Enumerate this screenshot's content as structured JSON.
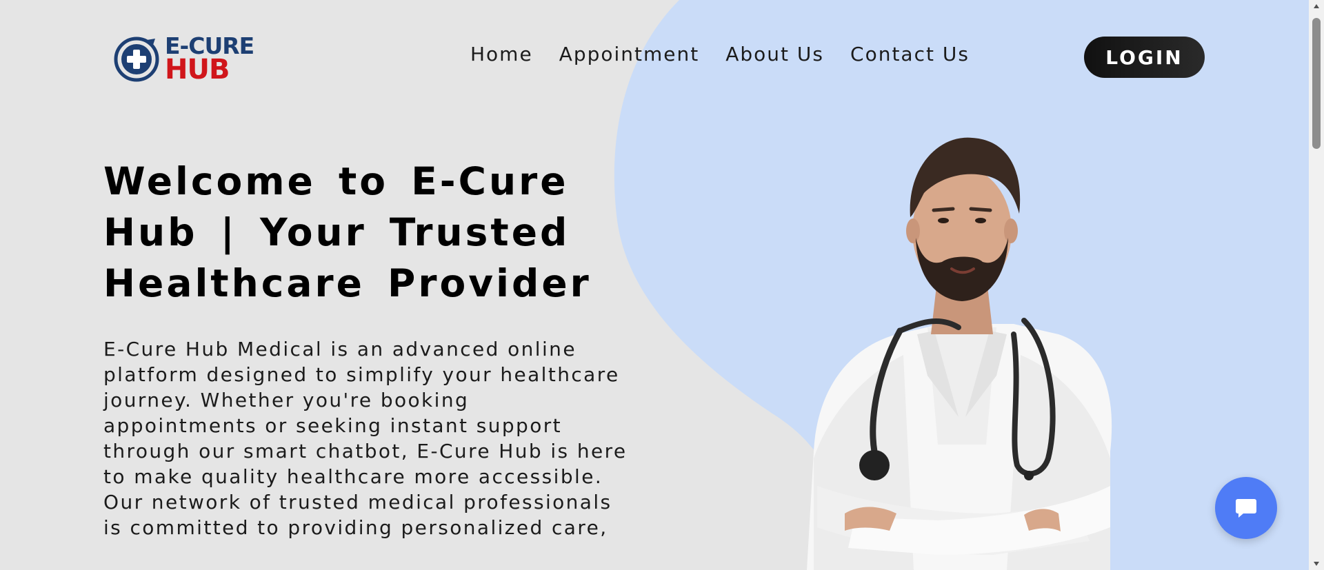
{
  "header": {
    "logo": {
      "line1": "E-CURE",
      "line2": "HUB"
    },
    "nav": [
      {
        "label": "Home"
      },
      {
        "label": "Appointment"
      },
      {
        "label": "About Us"
      },
      {
        "label": "Contact Us"
      }
    ],
    "login_label": "LOGIN"
  },
  "hero": {
    "title": "Welcome to E-Cure Hub | Your Trusted Healthcare Provider",
    "description": "E-Cure Hub Medical is an advanced online platform designed to simplify your healthcare journey. Whether you're booking appointments or seeking instant support through our smart chatbot, E-Cure Hub is here to make quality healthcare more accessible. Our network of trusted medical professionals is committed to providing personalized care,"
  },
  "icons": {
    "logo": "medical-cross-icon",
    "chat": "chat-bubble-icon",
    "doctor": "doctor-illustration"
  },
  "colors": {
    "background": "#e5e5e5",
    "accent_blob": "#cadcf8",
    "logo_blue": "#1d3f73",
    "logo_red": "#d0161b",
    "login_bg": "#111111",
    "chat_button": "#4f7cf6"
  }
}
